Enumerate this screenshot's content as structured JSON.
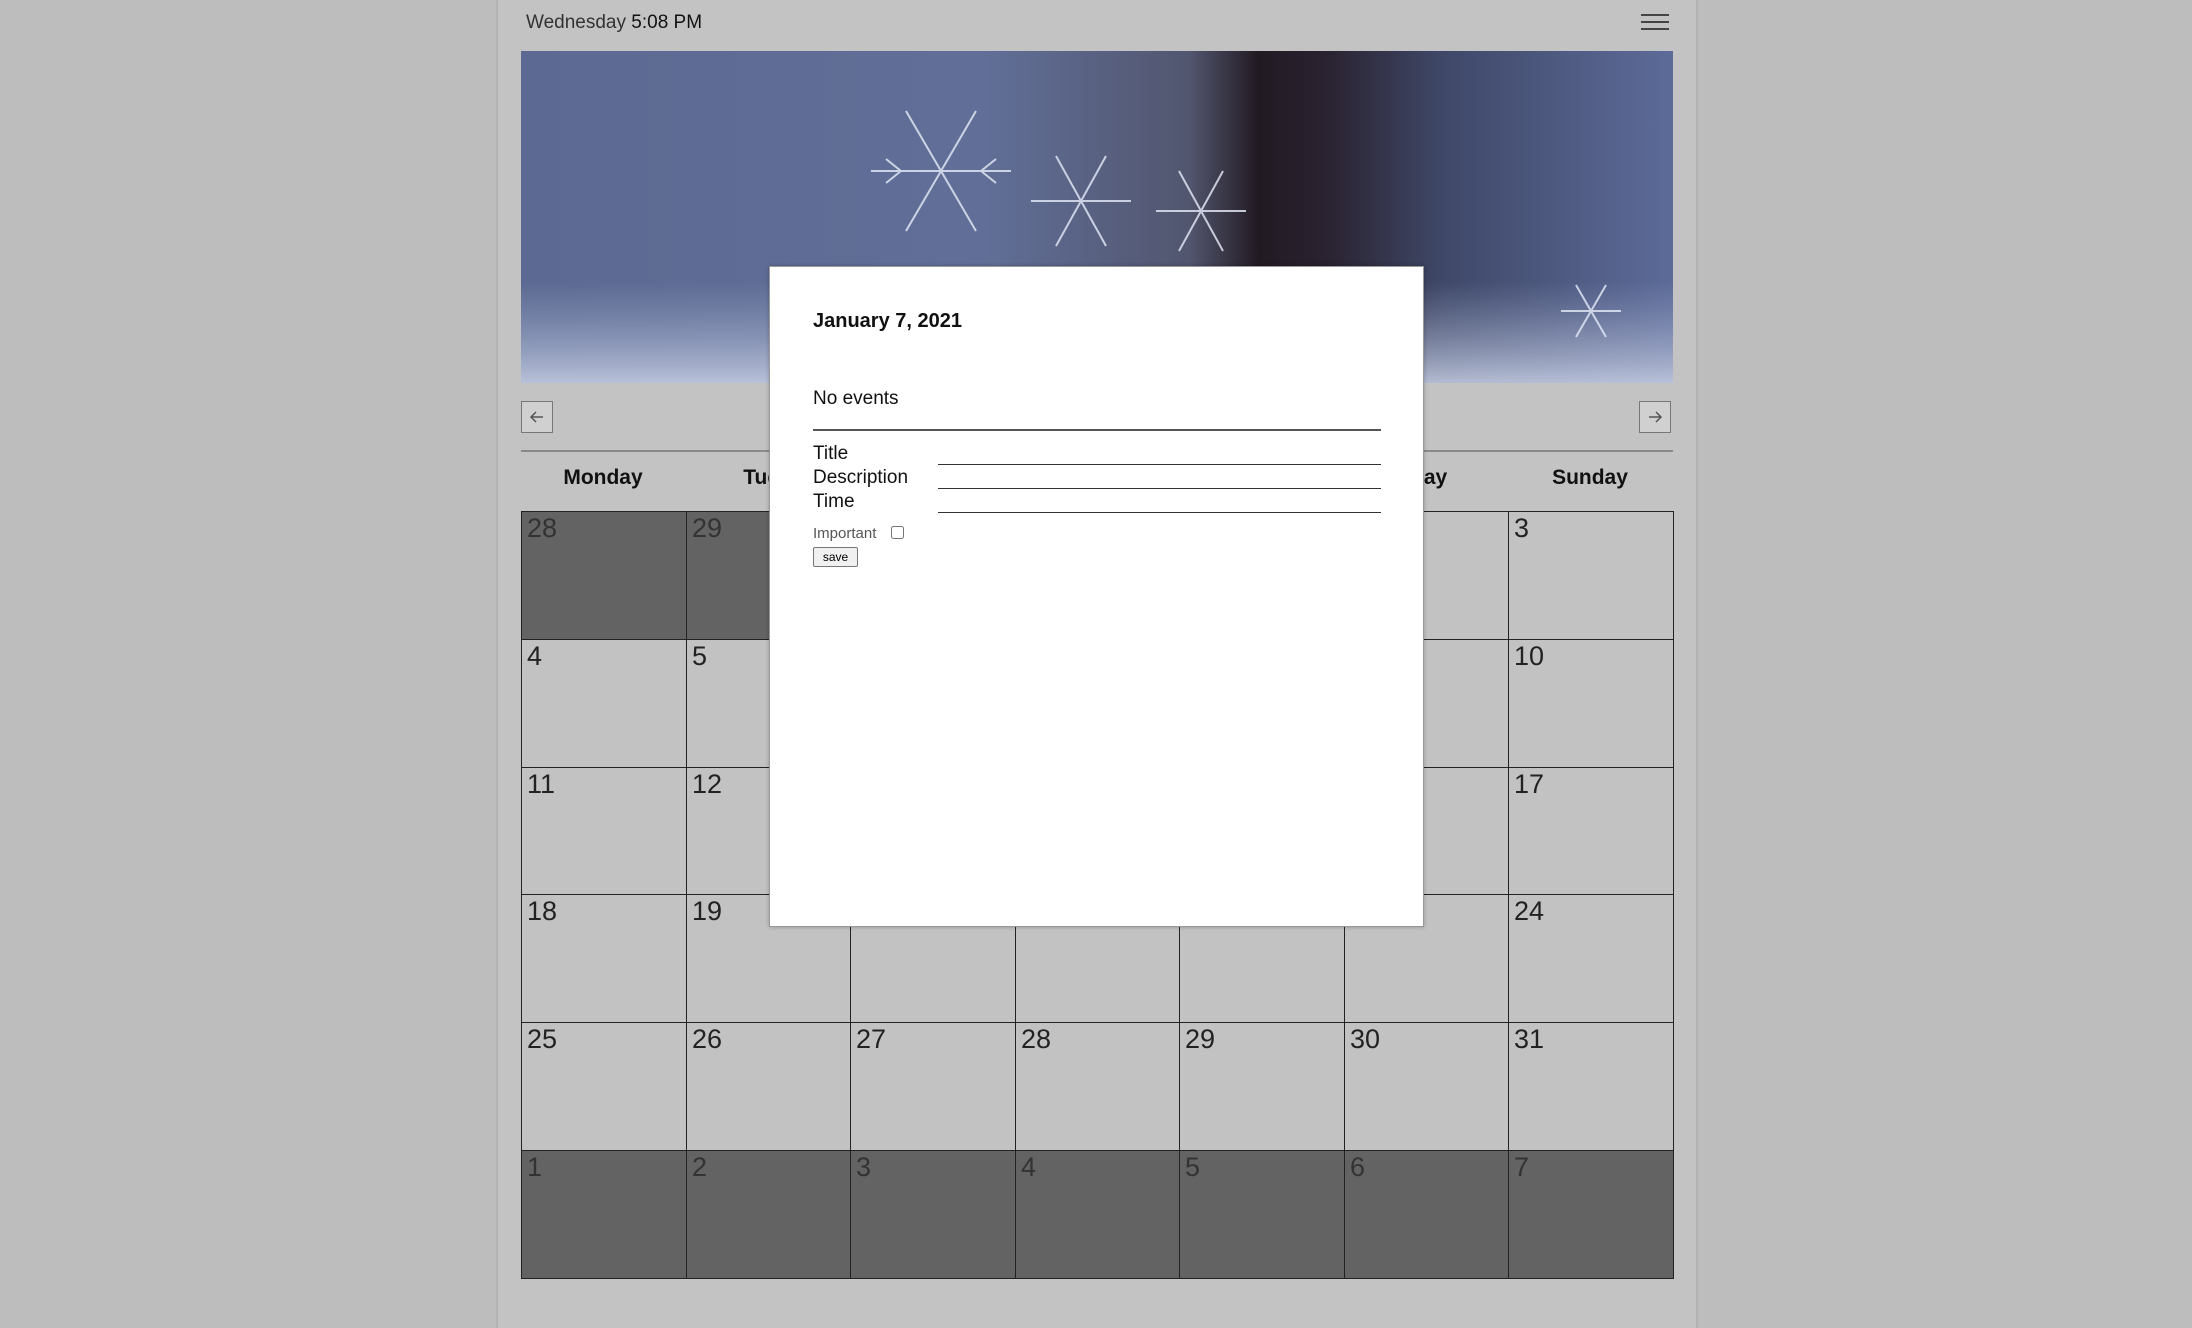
{
  "header": {
    "day": "Wednesday",
    "time": "5:08 PM"
  },
  "icons": {
    "menu": "hamburger-menu-icon",
    "prev": "arrow-left-icon",
    "next": "arrow-right-icon"
  },
  "weekdays": [
    "Monday",
    "Tues",
    "",
    "",
    "",
    "rday",
    "Sunday"
  ],
  "days": [
    [
      "28",
      "29",
      "",
      "",
      "",
      "",
      "3"
    ],
    [
      "4",
      "5",
      "",
      "",
      "",
      "",
      "10"
    ],
    [
      "11",
      "12",
      "",
      "",
      "",
      "",
      "17"
    ],
    [
      "18",
      "19",
      "",
      "",
      "",
      "",
      "24"
    ],
    [
      "25",
      "26",
      "27",
      "28",
      "29",
      "30",
      "31"
    ],
    [
      "1",
      "2",
      "3",
      "4",
      "5",
      "6",
      "7"
    ]
  ],
  "colors": {
    "current_month_cell": "#c2c2c2",
    "other_month_cell": "#636363",
    "modal_bg": "#ffffff"
  },
  "modal": {
    "date": "January 7, 2021",
    "no_events": "No events",
    "title_label": "Title",
    "description_label": "Description",
    "time_label": "Time",
    "title_value": "",
    "description_value": "",
    "time_value": "",
    "important_label": "Important",
    "important_checked": false,
    "save_label": "save"
  }
}
